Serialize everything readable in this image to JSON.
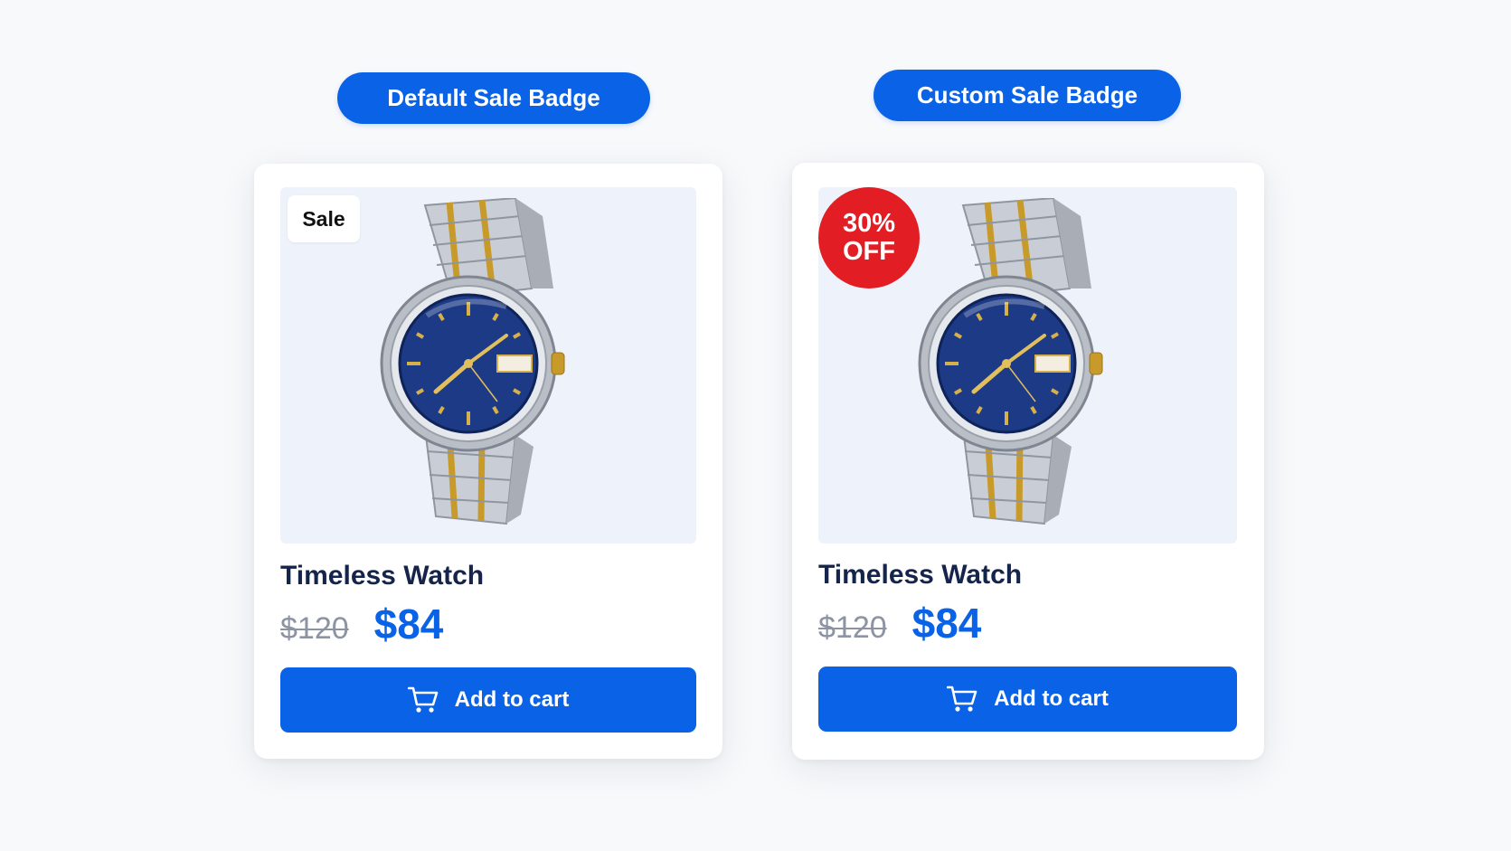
{
  "labels": {
    "left": "Default Sale Badge",
    "right": "Custom Sale Badge"
  },
  "cards": [
    {
      "badge": "Sale",
      "title": "Timeless Watch",
      "old_price": "$120",
      "new_price": "$84",
      "button": "Add to cart"
    },
    {
      "badge": "30% OFF",
      "title": "Timeless Watch",
      "old_price": "$120",
      "new_price": "$84",
      "button": "Add to cart"
    }
  ],
  "icons": {
    "cart": "shopping-cart-icon",
    "product": "watch-image"
  },
  "colors": {
    "accent": "#0a63e6",
    "sale_red": "#e21d24",
    "title": "#15244a",
    "old_price": "#8c93a3"
  }
}
